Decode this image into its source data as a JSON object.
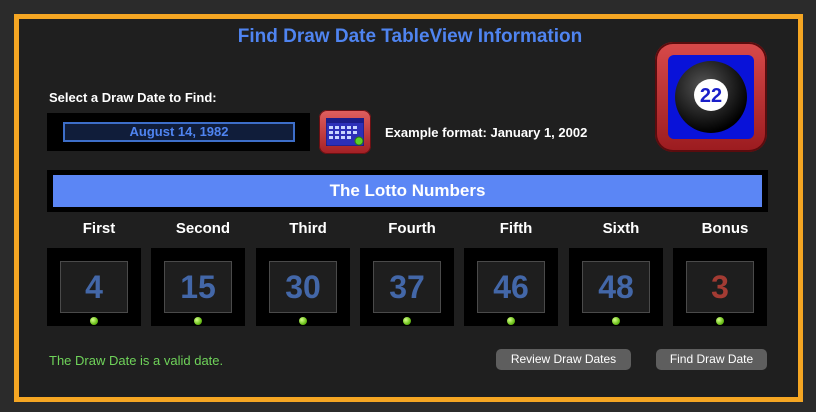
{
  "title": "Find Draw Date TableView Information",
  "prompt": "Select a Draw Date to Find:",
  "date_field": {
    "value": "August 14, 1982"
  },
  "example": "Example format: January 1, 2002",
  "ball_icon": {
    "number": "22"
  },
  "lotto_header": "The Lotto Numbers",
  "numbers": [
    {
      "label": "First",
      "value": "4"
    },
    {
      "label": "Second",
      "value": "15"
    },
    {
      "label": "Third",
      "value": "30"
    },
    {
      "label": "Fourth",
      "value": "37"
    },
    {
      "label": "Fifth",
      "value": "46"
    },
    {
      "label": "Sixth",
      "value": "48"
    },
    {
      "label": "Bonus",
      "value": "3"
    }
  ],
  "status": "The Draw Date is a valid date.",
  "buttons": {
    "review": "Review Draw Dates",
    "find": "Find Draw Date"
  },
  "colors": {
    "frame": "#f5a623",
    "accent": "#4f84f0",
    "status": "#6fd35a",
    "bonus": "#a33b33"
  }
}
